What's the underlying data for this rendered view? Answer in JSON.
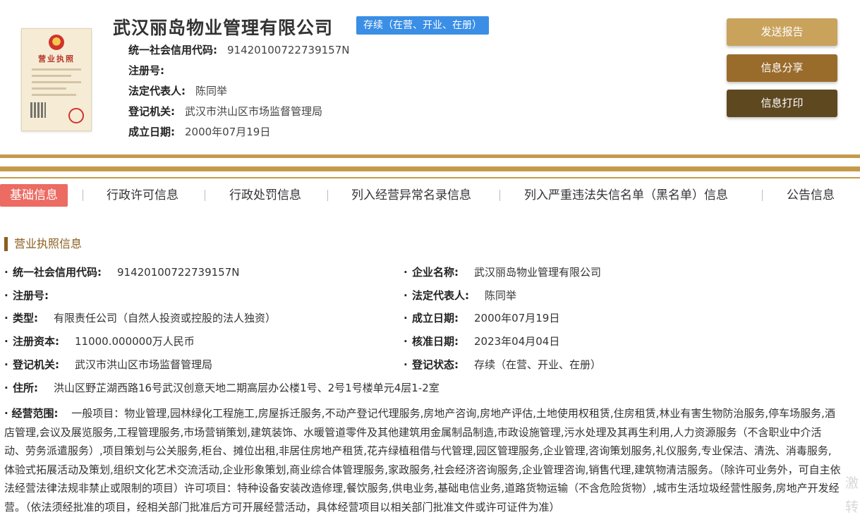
{
  "header": {
    "company_name": "武汉丽岛物业管理有限公司",
    "status_badge": "存续（在营、开业、在册）",
    "license_image": {
      "title": "营业执照"
    },
    "basic_info": [
      {
        "label": "统一社会信用代码:",
        "value": "91420100722739157N"
      },
      {
        "label": "注册号:",
        "value": ""
      },
      {
        "label": "法定代表人:",
        "value": "陈同举"
      },
      {
        "label": "登记机关:",
        "value": "武汉市洪山区市场监督管理局"
      },
      {
        "label": "成立日期:",
        "value": "2000年07月19日"
      }
    ]
  },
  "actions": {
    "send_report": "发送报告",
    "share": "信息分享",
    "print": "信息打印"
  },
  "colors": {
    "gold": "#c49a4a",
    "status_blue": "#3a8ee6",
    "active_tab": "#ec6b62",
    "section_brown": "#8b5e1e"
  },
  "tabs": [
    {
      "label": "基础信息",
      "active": true
    },
    {
      "label": "行政许可信息",
      "active": false
    },
    {
      "label": "行政处罚信息",
      "active": false
    },
    {
      "label": "列入经营异常名录信息",
      "active": false
    },
    {
      "label": "列入严重违法失信名单（黑名单）信息",
      "active": false
    },
    {
      "label": "公告信息",
      "active": false
    }
  ],
  "section": {
    "title": "营业执照信息",
    "bullet": "·",
    "left": [
      {
        "label": "统一社会信用代码:",
        "value": "91420100722739157N"
      },
      {
        "label": "注册号:",
        "value": ""
      },
      {
        "label": "类型:",
        "value": "有限责任公司（自然人投资或控股的法人独资）"
      },
      {
        "label": "注册资本:",
        "value": "11000.000000万人民币"
      },
      {
        "label": "登记机关:",
        "value": "武汉市洪山区市场监督管理局"
      }
    ],
    "right": [
      {
        "label": "企业名称:",
        "value": "武汉丽岛物业管理有限公司"
      },
      {
        "label": "法定代表人:",
        "value": "陈同举"
      },
      {
        "label": "成立日期:",
        "value": "2000年07月19日"
      },
      {
        "label": "核准日期:",
        "value": "2023年04月04日"
      },
      {
        "label": "登记状态:",
        "value": "存续（在营、开业、在册）"
      }
    ],
    "address": {
      "label": "住所:",
      "value": "洪山区野芷湖西路16号武汉创意天地二期高层办公楼1号、2号1号楼单元4层1-2室"
    },
    "scope": {
      "label": "经营范围:",
      "value": "一般项目：物业管理,园林绿化工程施工,房屋拆迁服务,不动产登记代理服务,房地产咨询,房地产评估,土地使用权租赁,住房租赁,林业有害生物防治服务,停车场服务,酒店管理,会议及展览服务,工程管理服务,市场营销策划,建筑装饰、水暖管道零件及其他建筑用金属制品制造,市政设施管理,污水处理及其再生利用,人力资源服务（不含职业中介活动、劳务派遣服务）,项目策划与公关服务,柜台、摊位出租,非居住房地产租赁,花卉绿植租借与代管理,园区管理服务,企业管理,咨询策划服务,礼仪服务,专业保洁、清洗、消毒服务,体验式拓展活动及策划,组织文化艺术交流活动,企业形象策划,商业综合体管理服务,家政服务,社会经济咨询服务,企业管理咨询,销售代理,建筑物清洁服务。（除许可业务外，可自主依法经营法律法规非禁止或限制的项目）许可项目：特种设备安装改造修理,餐饮服务,供电业务,基础电信业务,道路货物运输（不含危险货物）,城市生活垃圾经营性服务,房地产开发经营。（依法须经批准的项目，经相关部门批准后方可开展经营活动，具体经营项目以相关部门批准文件或许可证件为准）"
    }
  },
  "watermark": "激转"
}
